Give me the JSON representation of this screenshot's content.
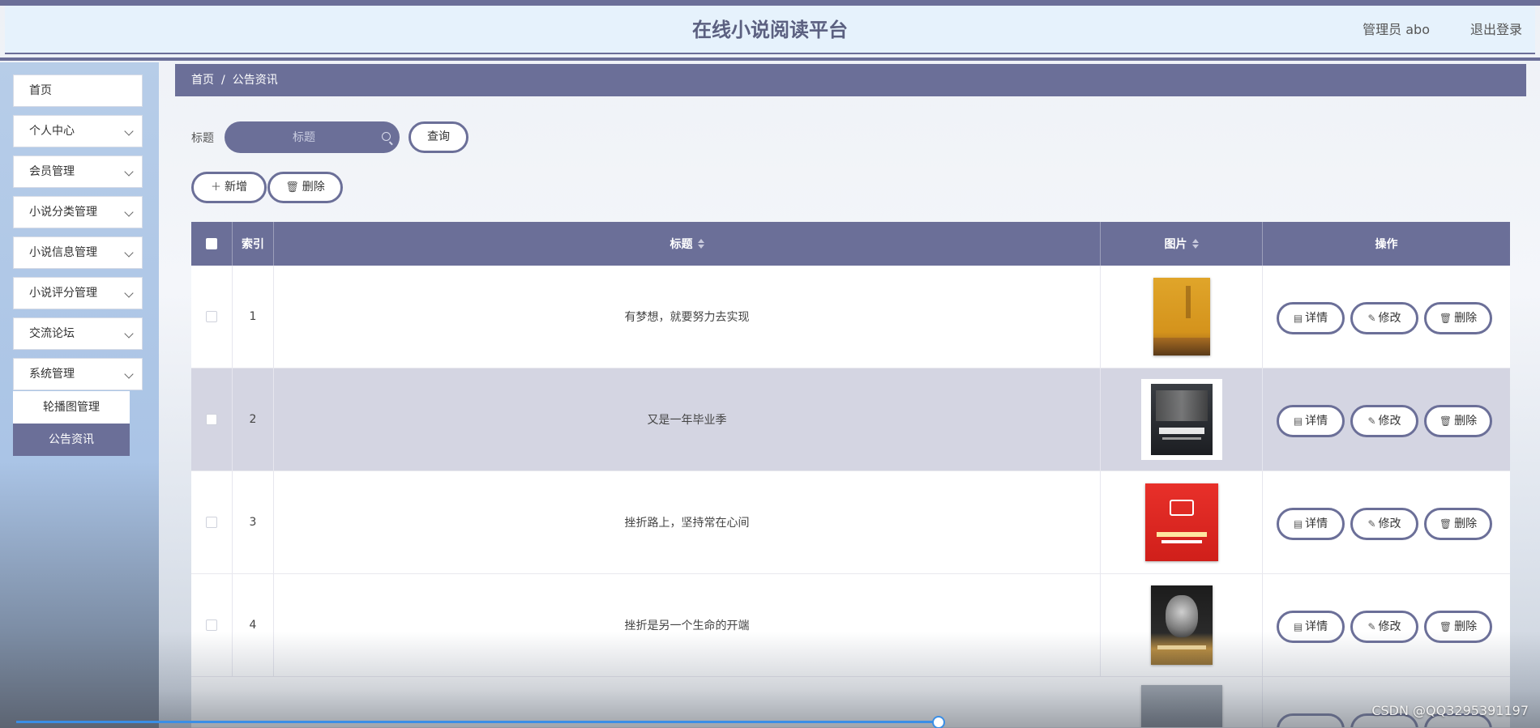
{
  "header": {
    "title": "在线小说阅读平台",
    "admin": "管理员 abo",
    "logout": "退出登录"
  },
  "sidebar": {
    "items": [
      {
        "label": "首页"
      },
      {
        "label": "个人中心"
      },
      {
        "label": "会员管理"
      },
      {
        "label": "小说分类管理"
      },
      {
        "label": "小说信息管理"
      },
      {
        "label": "小说评分管理"
      },
      {
        "label": "交流论坛"
      },
      {
        "label": "系统管理"
      }
    ],
    "submenu": [
      {
        "label": "轮播图管理"
      },
      {
        "label": "公告资讯"
      }
    ]
  },
  "breadcrumb": {
    "home": "首页",
    "separator": "/",
    "current": "公告资讯"
  },
  "search": {
    "label": "标题",
    "placeholder": "标题",
    "button": "查询"
  },
  "toolbar": {
    "add": "新增",
    "delete": "删除"
  },
  "table": {
    "headers": {
      "index": "索引",
      "title": "标题",
      "image": "图片",
      "actions": "操作"
    },
    "rows": [
      {
        "index": "1",
        "title": "有梦想，就要努力去实现"
      },
      {
        "index": "2",
        "title": "又是一年毕业季"
      },
      {
        "index": "3",
        "title": "挫折路上，坚持常在心间"
      },
      {
        "index": "4",
        "title": "挫折是另一个生命的开端"
      }
    ],
    "row_actions": {
      "detail": "详情",
      "edit": "修改",
      "delete": "删除"
    }
  },
  "watermark": "CSDN @QQ3295391197",
  "colors": {
    "accent": "#6b6f98",
    "header_bg": "#e6f2fc",
    "progress": "#3a8ee6"
  }
}
